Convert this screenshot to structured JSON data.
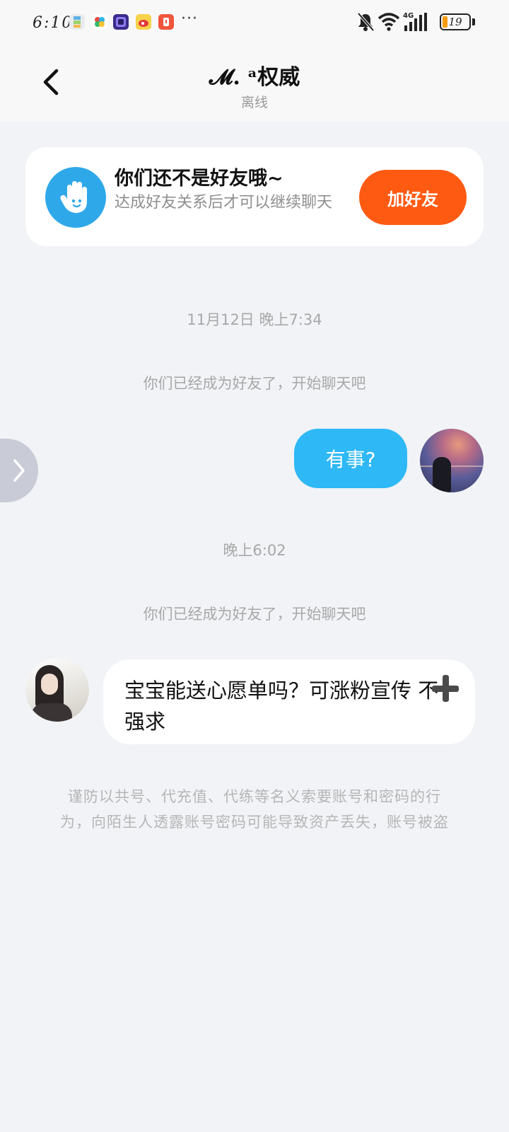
{
  "status_bar": {
    "time": "6:10",
    "more": "···",
    "network": "4G",
    "battery": "19",
    "battery_percent": 19
  },
  "header": {
    "contact_name": "𝓜.  ᵃ权威",
    "status": "离线",
    "back_icon": "chevron-left-icon"
  },
  "friend_card": {
    "title": "你们还不是好友哦~",
    "description": "达成好友关系后才可以继续聊天",
    "add_button": "加好友",
    "icon": "waving-hand-icon"
  },
  "chat": {
    "timestamp_1": "11月12日 晚上7:34",
    "system_1": "你们已经成为好友了，开始聊天吧",
    "outgoing_message": "有事?",
    "timestamp_2": "晚上6:02",
    "system_2": "你们已经成为好友了，开始聊天吧",
    "incoming_message": "宝宝能送心愿单吗？可涨粉宣传 不强求",
    "incoming_emoji": "heavy-plus-icon"
  },
  "safety_notice": "谨防以共号、代充值、代练等名义索要账号和密码的行为，向陌生人透露账号密码可能导致资产丢失，账号被盗",
  "colors": {
    "background": "#f1f3f6",
    "outgoing_bubble": "#2eb8f5",
    "add_button": "#ff5a12",
    "hand_avatar": "#2fa8ea"
  }
}
